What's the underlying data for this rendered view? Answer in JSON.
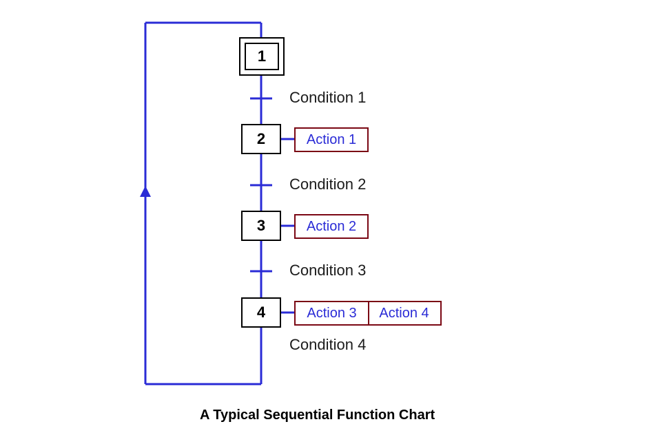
{
  "caption": "A Typical Sequential Function Chart",
  "steps": {
    "s1": "1",
    "s2": "2",
    "s3": "3",
    "s4": "4"
  },
  "conditions": {
    "c1": "Condition 1",
    "c2": "Condition 2",
    "c3": "Condition 3",
    "c4": "Condition 4"
  },
  "actions": {
    "a1": "Action 1",
    "a2": "Action 2",
    "a3": "Action 3",
    "a4": "Action 4"
  },
  "colors": {
    "flow_line": "#2a2bd6",
    "action_border": "#7a0713",
    "action_text": "#2a2bd6",
    "step_border": "#000000",
    "label_text": "#1b1b1b"
  }
}
